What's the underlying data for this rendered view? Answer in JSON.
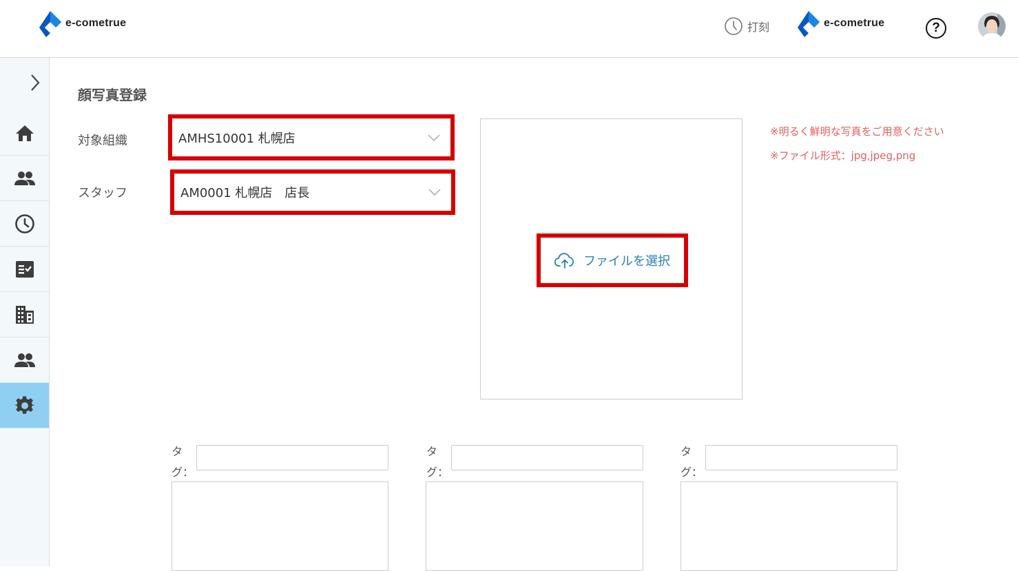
{
  "header": {
    "logo_text": "e-cometrue",
    "punch_label": "打刻",
    "company_logo_text": "e-cometrue",
    "help_label": "?"
  },
  "sidebar": {
    "items": [
      {
        "icon": "home-icon",
        "active": false
      },
      {
        "icon": "people-icon",
        "active": false
      },
      {
        "icon": "clock-icon",
        "active": false
      },
      {
        "icon": "checklist-icon",
        "active": false
      },
      {
        "icon": "building-icon",
        "active": false
      },
      {
        "icon": "people-icon",
        "active": false
      },
      {
        "icon": "gear-icon",
        "active": true
      }
    ],
    "active_color": "#8fd0f2"
  },
  "main": {
    "title": "顔写真登録",
    "organization": {
      "label": "対象組織",
      "value": "AMHS10001 札幌店"
    },
    "staff": {
      "label": "スタッフ",
      "value": "AM0001 札幌店　店長"
    },
    "upload": {
      "button_label": "ファイルを選択"
    },
    "notes": [
      "※明るく鮮明な写真をご用意ください",
      "※ファイル形式：jpg,jpeg,png"
    ],
    "tags": [
      {
        "label": "タグ：",
        "value": ""
      },
      {
        "label": "タグ：",
        "value": ""
      },
      {
        "label": "タグ：",
        "value": ""
      }
    ]
  },
  "colors": {
    "highlight": "#d70000",
    "note": "#e0605e",
    "link": "#2a7fb8"
  }
}
